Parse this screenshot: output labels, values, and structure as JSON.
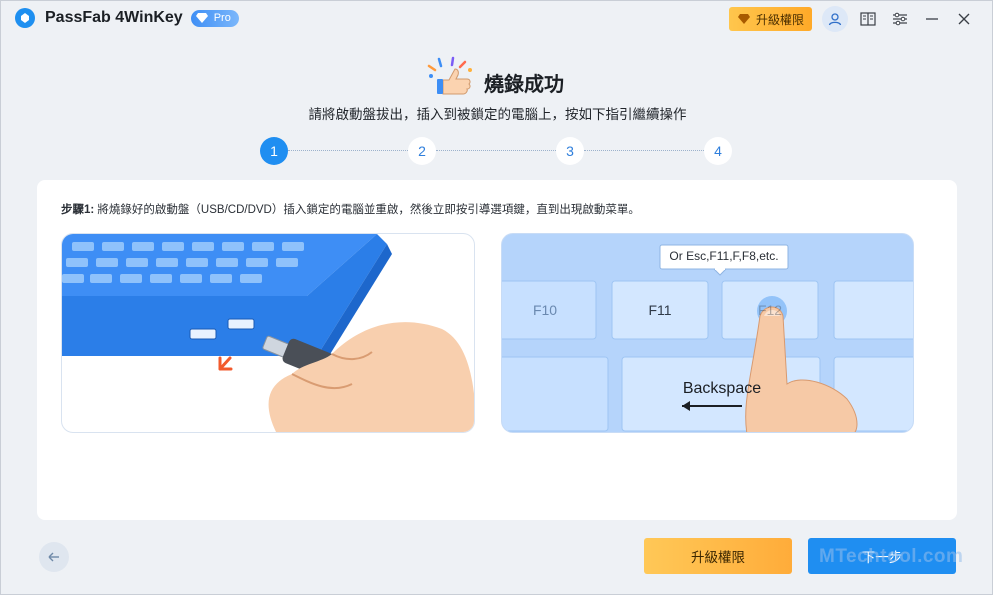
{
  "app": {
    "name": "PassFab 4WinKey",
    "badge": "Pro"
  },
  "titlebar": {
    "upgrade_label": "升級權限"
  },
  "header": {
    "title": "燒錄成功",
    "subtitle": "請將啟動盤拔出，插入到被鎖定的電腦上，按如下指引繼續操作"
  },
  "stepper": {
    "steps": [
      "1",
      "2",
      "3",
      "4"
    ],
    "active_index": 0
  },
  "card": {
    "step_label": "步驟1:",
    "instruction": " 將燒錄好的啟動盤（USB/CD/DVD）插入鎖定的電腦並重啟，然後立即按引導選項鍵，直到出現啟動菜單。",
    "keys": {
      "hint": "Or Esc,F11,F,F8,etc.",
      "f10": "F10",
      "f11": "F11",
      "f12": "F12",
      "backspace": "Backspace"
    }
  },
  "footer": {
    "upgrade_label": "升級權限",
    "next_label": "下一步",
    "watermark": "MTechtool.com"
  },
  "colors": {
    "accent": "#1f8ef1",
    "upgrade": "#ffac3a",
    "background": "#eef1f5"
  }
}
